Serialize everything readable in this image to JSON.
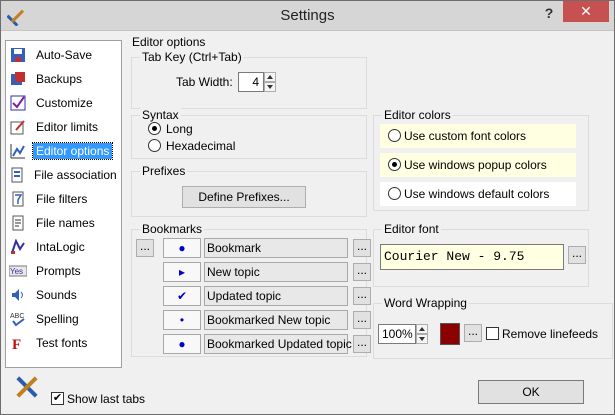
{
  "window": {
    "title": "Settings",
    "help": "?",
    "close": "✕"
  },
  "sidebar": {
    "items": [
      {
        "label": "Auto-Save",
        "icon": "save-icon"
      },
      {
        "label": "Backups",
        "icon": "backup-icon"
      },
      {
        "label": "Customize",
        "icon": "checkmark-icon"
      },
      {
        "label": "Editor limits",
        "icon": "edit-icon"
      },
      {
        "label": "Editor options",
        "icon": "chart-icon"
      },
      {
        "label": "File association",
        "icon": "file-icon"
      },
      {
        "label": "File filters",
        "icon": "filter-icon"
      },
      {
        "label": "File names",
        "icon": "document-icon"
      },
      {
        "label": "IntaLogic",
        "icon": "logic-icon"
      },
      {
        "label": "Prompts",
        "icon": "yes-icon"
      },
      {
        "label": "Sounds",
        "icon": "speaker-icon"
      },
      {
        "label": "Spelling",
        "icon": "spelling-icon"
      },
      {
        "label": "Test fonts",
        "icon": "font-icon"
      }
    ],
    "selected": "Editor options"
  },
  "editor_options": {
    "heading": "Editor options",
    "tab_key": {
      "label": "Tab Key  (Ctrl+Tab)",
      "width_label": "Tab Width:",
      "width_value": "4"
    },
    "syntax": {
      "label": "Syntax",
      "options": [
        "Long",
        "Hexadecimal"
      ],
      "selected": "Long"
    },
    "prefixes": {
      "label": "Prefixes",
      "button": "Define Prefixes..."
    },
    "bookmarks": {
      "label": "Bookmarks",
      "rows": [
        {
          "icon": "●",
          "text": "Bookmark"
        },
        {
          "icon": "▸",
          "text": "New topic"
        },
        {
          "icon": "✔",
          "text": "Updated topic"
        },
        {
          "icon": "•",
          "text": "Bookmarked New topic"
        },
        {
          "icon": "●",
          "text": "Bookmarked Updated topic"
        }
      ],
      "button": "..."
    },
    "editor_colors": {
      "label": "Editor colors",
      "options": [
        "Use custom font colors",
        "Use windows popup colors",
        "Use windows default colors"
      ],
      "selected": "Use windows popup colors"
    },
    "editor_font": {
      "label": "Editor font",
      "value": "Courier New - 9.75",
      "button": "..."
    },
    "word_wrapping": {
      "label": "Word Wrapping",
      "percent": "100%",
      "swatch_color": "#8b0000",
      "button": "...",
      "remove_linefeeds": "Remove linefeeds",
      "remove_linefeeds_checked": false
    }
  },
  "footer": {
    "show_last_tabs": "Show last tabs",
    "show_last_tabs_checked": true,
    "ok": "OK"
  }
}
